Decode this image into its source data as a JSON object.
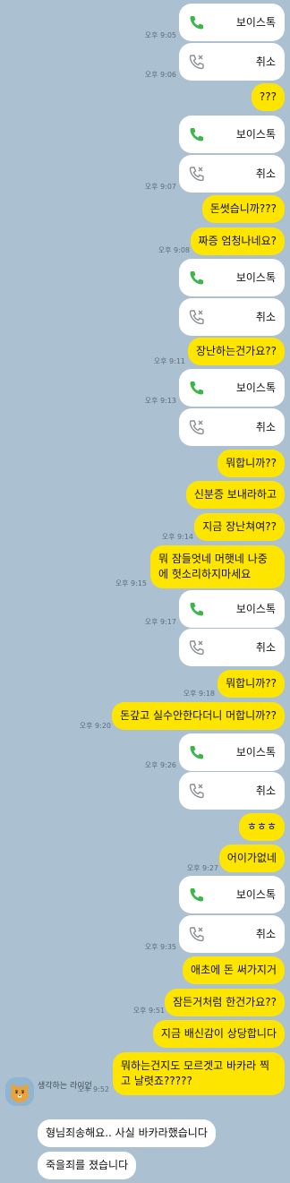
{
  "colors": {
    "background": "#abc1d1",
    "my_bubble": "#fee500",
    "their_bubble": "#ffffff",
    "call_green": "#3cb54a",
    "cancel_gray": "#8a8f94"
  },
  "calls": [
    {
      "label": "보이스톡",
      "status": "voice-call-icon"
    },
    {
      "label": "취소",
      "status": "canceled-call-icon",
      "time": "오후 9:05"
    },
    {
      "label": "취소",
      "status": "canceled-call-icon",
      "time": "오후 9:06"
    },
    {
      "label": "보이스톡",
      "status": "voice-call-icon"
    },
    {
      "label": "취소",
      "status": "canceled-call-icon",
      "time": "오후 9:07"
    },
    {
      "label": "보이스톡",
      "status": "voice-call-icon"
    },
    {
      "label": "취소",
      "status": "canceled-call-icon",
      "time": "오후 9:11"
    },
    {
      "label": "보이스톡",
      "status": "voice-call-icon"
    },
    {
      "label": "취소",
      "status": "canceled-call-icon"
    },
    {
      "label": "보이스톡",
      "status": "voice-call-icon"
    },
    {
      "label": "취소",
      "status": "canceled-call-icon"
    },
    {
      "label": "보이스톡",
      "status": "voice-call-icon"
    },
    {
      "label": "취소",
      "status": "canceled-call-icon"
    },
    {
      "label": "보이스톡",
      "status": "voice-call-icon"
    },
    {
      "label": "취소",
      "status": "canceled-call-icon"
    }
  ],
  "messages": {
    "m1": "???",
    "m2": "돈썻습니까???",
    "m3": "짜증 엄청나네요?",
    "m4": "장난하는건가요??",
    "m5": "뭐합니까??",
    "m6": "신분증 보내라하고",
    "m7": "지금 장난쳐여??",
    "m8": "뭐 잠들엇네 머햇네 나중에 헛소리하지마세요",
    "m9": "뭐합니까??",
    "m10": "돈갚고 실수안한다더니 머합니까??",
    "m11": "ㅎㅎㅎ",
    "m12": "어이가없네",
    "m13": "애초에 돈 써가지거",
    "m14": "잠든거처럼 한건가요??",
    "m15": "지금 배신감이 상당합니다",
    "m16": "뭐하는건지도 모르겟고 바카라 찍고 날렷죠?????"
  },
  "times": {
    "t1": "오후 9:05",
    "t2": "오후 9:06",
    "t3": "오후 9:07",
    "t4": "오후 9:08",
    "t5": "오후 9:11",
    "t6": "오후 9:13",
    "t7": "오후 9:14",
    "t8": "오후 9:15",
    "t9": "오후 9:17",
    "t10": "오후 9:18",
    "t11": "오후 9:20",
    "t12": "오후 9:26",
    "t13": "오후 9:27",
    "t14": "오후 9:35",
    "t15": "오후 9:51",
    "t16": "오후 9:52"
  },
  "reply": {
    "sender": "생각하는 라이언",
    "msg1": "형님죄송해요.. 사실 바카라했습니다",
    "msg2": "죽을죄를 졌습니다"
  }
}
